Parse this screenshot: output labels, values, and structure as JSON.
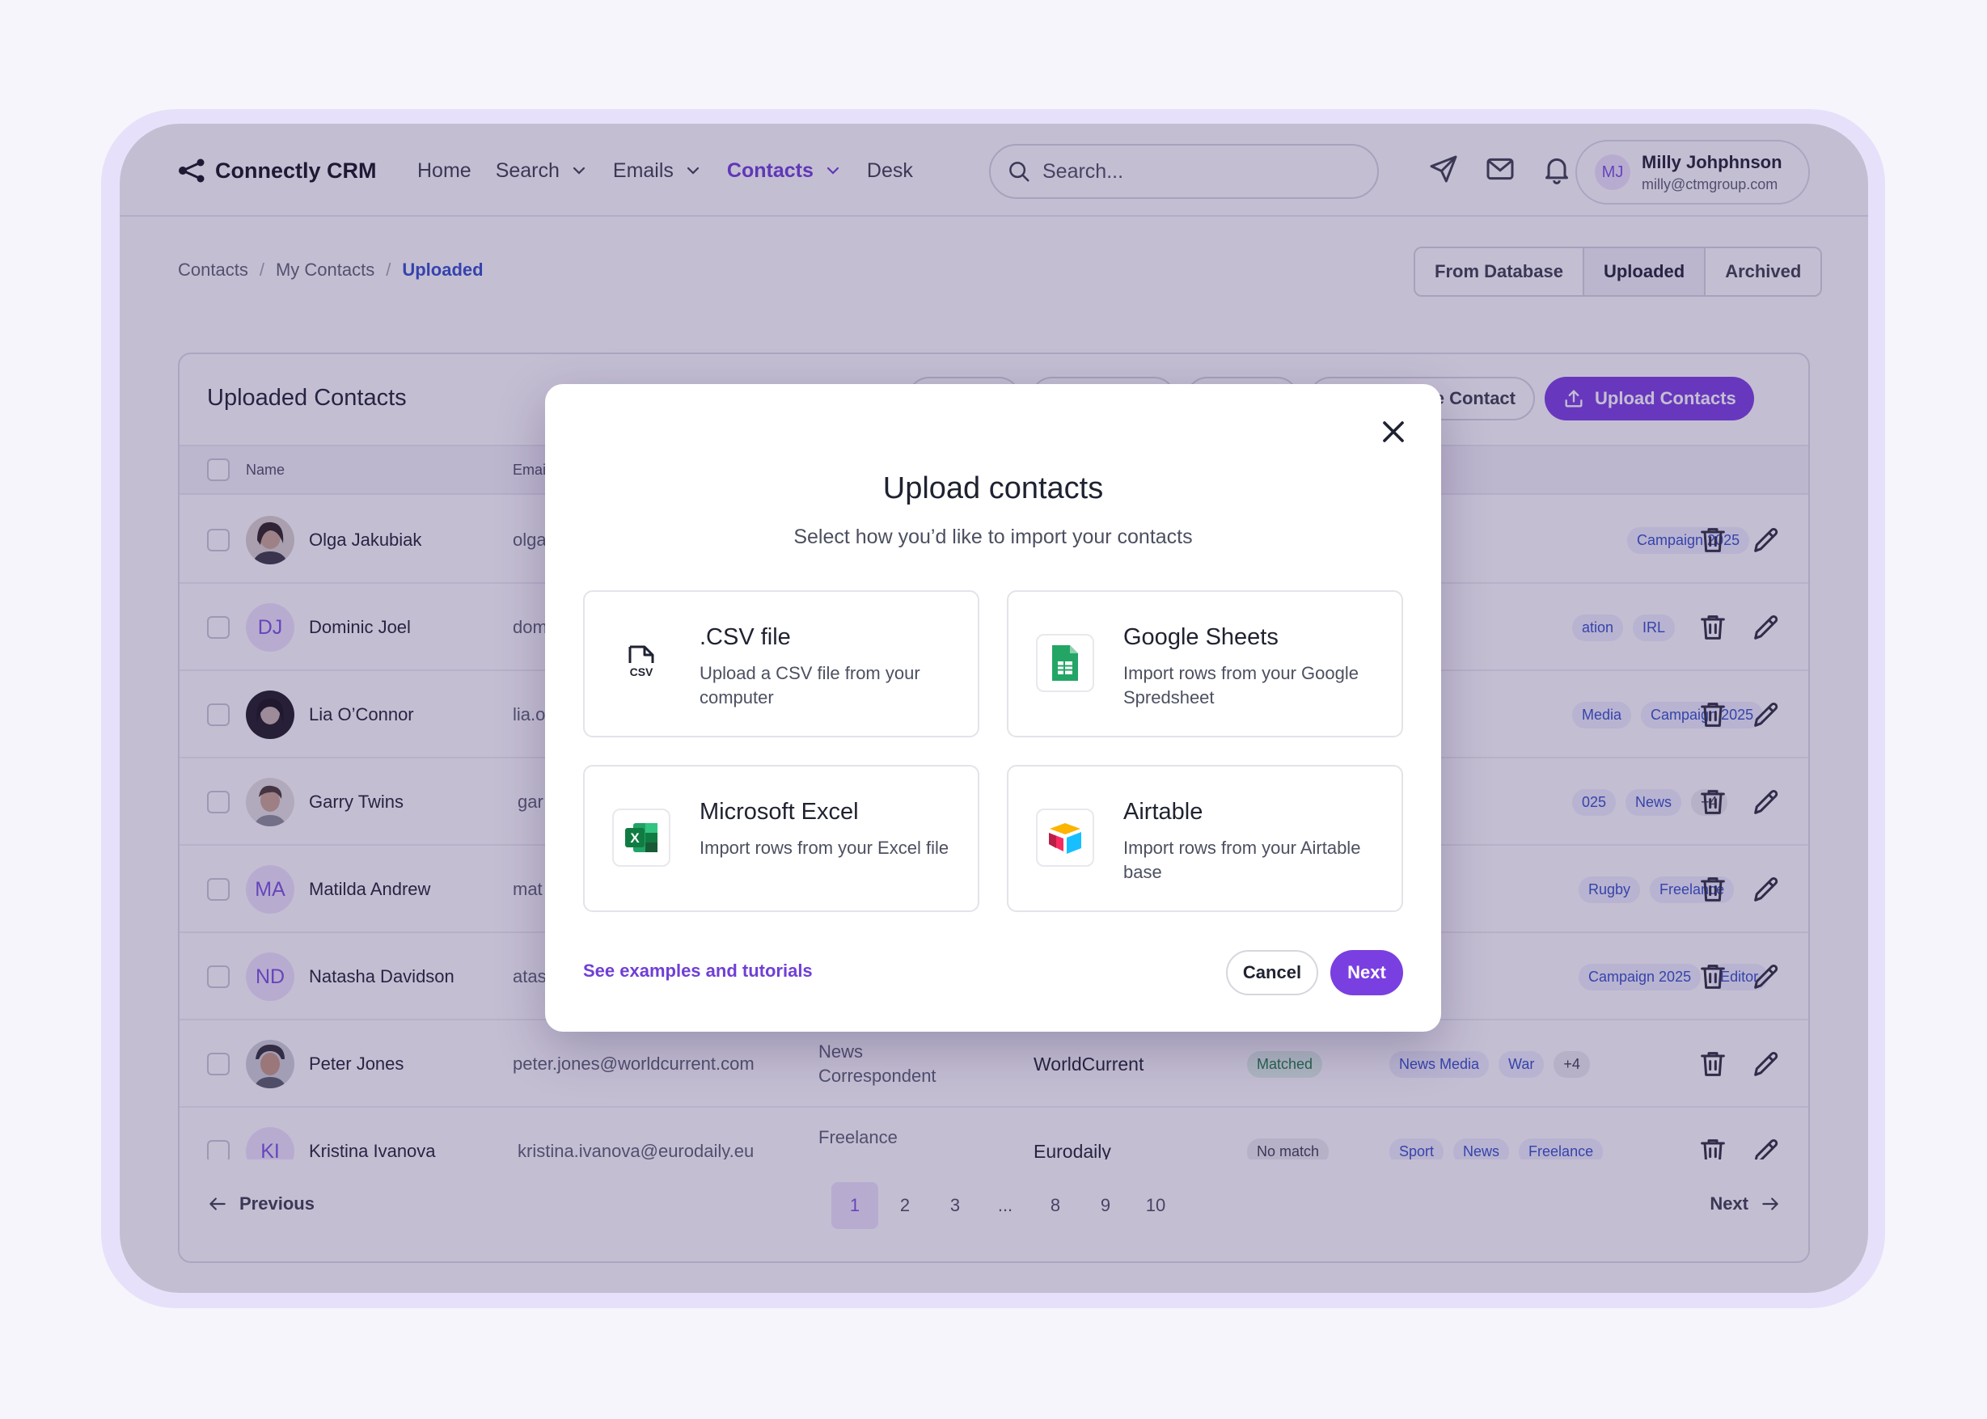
{
  "app": {
    "name": "Connectly CRM"
  },
  "nav": {
    "home": "Home",
    "search": "Search",
    "emails": "Emails",
    "contacts": "Contacts",
    "desk": "Desk"
  },
  "search": {
    "placeholder": "Search..."
  },
  "user": {
    "initials": "MJ",
    "name": "Milly Johphnson",
    "email": "milly@ctmgroup.com"
  },
  "breadcrumb": {
    "level1": "Contacts",
    "level2": "My Contacts",
    "current": "Uploaded"
  },
  "segments": [
    "From Database",
    "Uploaded",
    "Archived"
  ],
  "card": {
    "title": "Uploaded Contacts",
    "add_single_label": "Add Single Contact",
    "upload_label": "Upload Contacts"
  },
  "table": {
    "headers": {
      "name": "Name",
      "email": "Email"
    },
    "rows": [
      {
        "name": "Olga Jakubiak",
        "email": "olga",
        "tags": [
          "Campaign 2025"
        ]
      },
      {
        "name": "Dominic Joel",
        "initials": "DJ",
        "email": "dom",
        "tags": [
          "ation",
          "IRL"
        ]
      },
      {
        "name": "Lia O’Connor",
        "email": "lia.o",
        "tags": [
          "Media",
          "Campaign 2025"
        ]
      },
      {
        "name": "Garry Twins",
        "email": "gar",
        "tags": [
          "025",
          "News",
          "+4"
        ]
      },
      {
        "name": "Matilda Andrew",
        "initials": "MA",
        "email": "mat",
        "tags": [
          "Rugby",
          "Freelance"
        ]
      },
      {
        "name": "Natasha Davidson",
        "initials": "ND",
        "email": "atas",
        "tags": [
          "Campaign 2025",
          "Editor"
        ]
      },
      {
        "name": "Peter Jones",
        "email": "peter.jones@worldcurrent.com",
        "title": "News Correspondent",
        "org": "WorldCurrent",
        "status": "Matched",
        "tags": [
          "News Media",
          "War",
          "+4"
        ]
      },
      {
        "name": "Kristina Ivanova",
        "initials": "KI",
        "email": "kristina.ivanova@eurodaily.eu",
        "title": "Freelance",
        "org": "Eurodaily",
        "status": "No match",
        "tags": [
          "Sport",
          "News",
          "Freelance"
        ]
      }
    ]
  },
  "pagination": {
    "previous": "Previous",
    "next": "Next",
    "pages": [
      "1",
      "2",
      "3",
      "...",
      "8",
      "9",
      "10"
    ],
    "current": "1"
  },
  "modal": {
    "title": "Upload contacts",
    "subtitle": "Select how you’d like to import your contacts",
    "options": [
      {
        "title": ".CSV file",
        "desc": "Upload a CSV file from your computer",
        "icon": "csv-file-icon"
      },
      {
        "title": "Google Sheets",
        "desc": "Import rows from your Google Spredsheet",
        "icon": "google-sheets-icon"
      },
      {
        "title": "Microsoft Excel",
        "desc": "Import rows from your Excel file",
        "icon": "excel-icon"
      },
      {
        "title": "Airtable",
        "desc": "Import rows from your Airtable base",
        "icon": "airtable-icon"
      }
    ],
    "csv_icon_text": "CSV",
    "excel_icon_text": "X",
    "tutorial_link": "See examples and tutorials",
    "cancel": "Cancel",
    "next": "Next"
  },
  "colors": {
    "accent": "#7a3fe0",
    "link_blue": "#3350c8",
    "overlay": "#3a286e",
    "frame": "#e7e0fa"
  }
}
